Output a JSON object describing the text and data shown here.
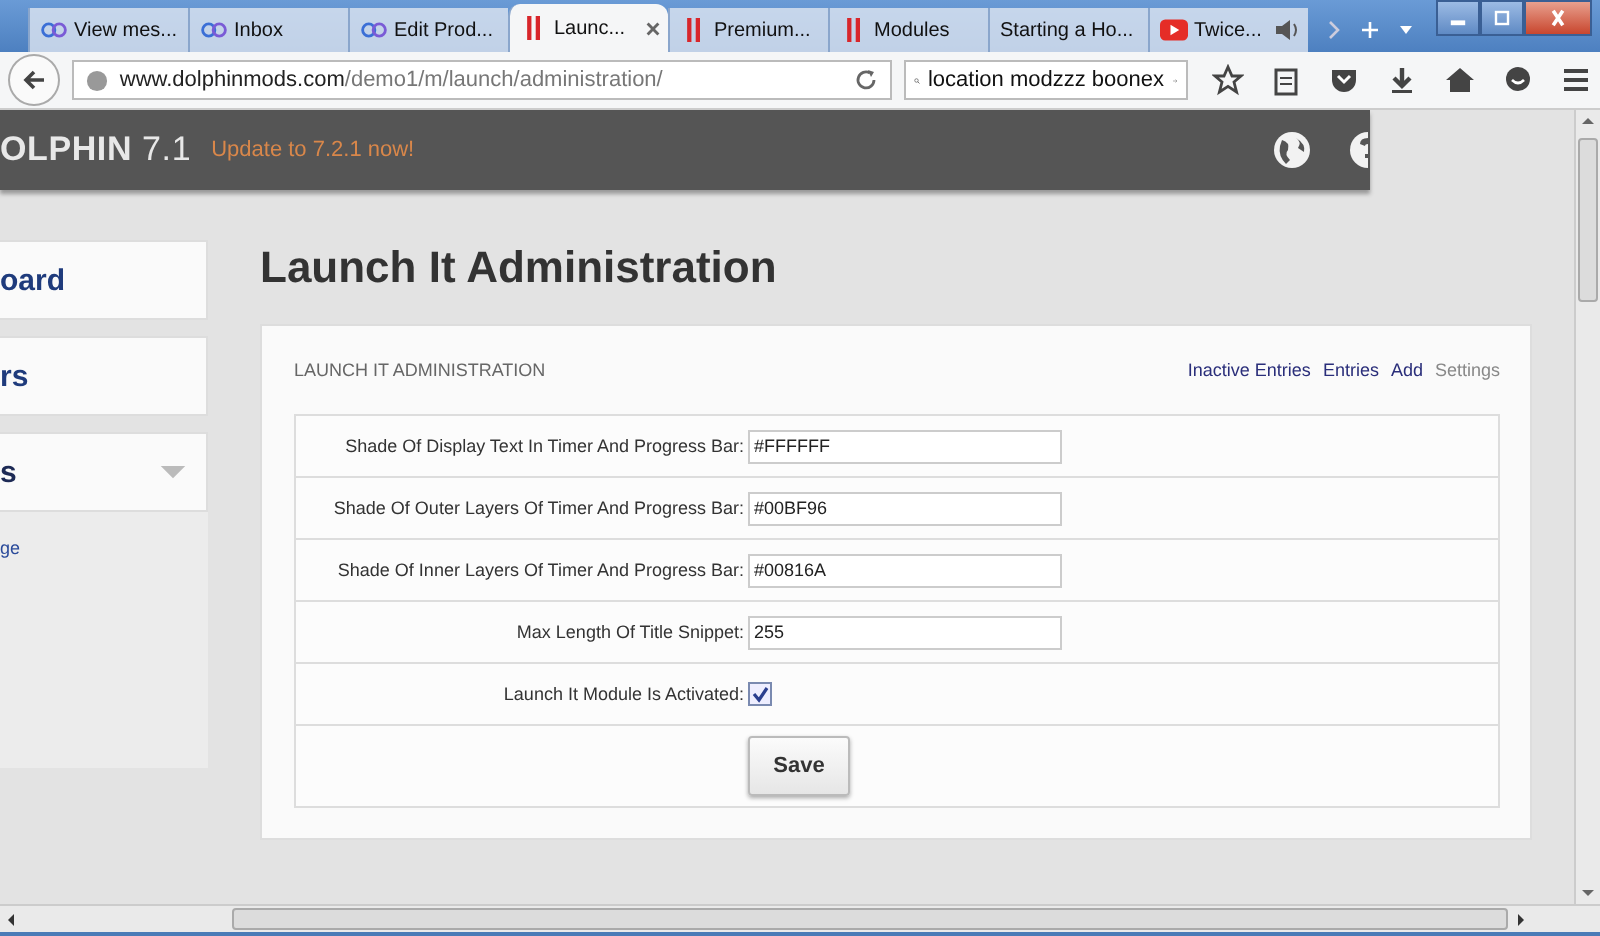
{
  "browser": {
    "tabs": [
      {
        "label": "View mes...",
        "kind": "circles",
        "selected": false
      },
      {
        "label": "Inbox",
        "kind": "circles",
        "selected": false
      },
      {
        "label": "Edit Prod...",
        "kind": "circles",
        "selected": false
      },
      {
        "label": "Launc...",
        "kind": "bars",
        "selected": true
      },
      {
        "label": "Premium...",
        "kind": "bars",
        "selected": false
      },
      {
        "label": "Modules",
        "kind": "bars",
        "selected": false
      },
      {
        "label": "Starting a Ho...",
        "kind": "plain",
        "selected": false
      },
      {
        "label": "Twice...",
        "kind": "video",
        "selected": false
      }
    ],
    "address": {
      "host": "www.dolphinmods.com",
      "path": "/demo1/m/launch/administration/"
    },
    "search": {
      "value": "location modzzz boonex"
    }
  },
  "header": {
    "logo": "OLPHIN",
    "version": "7.1",
    "update_link": "Update to 7.2.1 now!"
  },
  "sidebar": {
    "items": [
      {
        "label": "oard",
        "kind": "card"
      },
      {
        "label": "rs",
        "kind": "card"
      },
      {
        "label": "s",
        "kind": "menu"
      },
      {
        "label": "ge",
        "kind": "link"
      }
    ]
  },
  "page_title": "Launch It Administration",
  "panel": {
    "title": "LAUNCH IT ADMINISTRATION",
    "links": [
      {
        "label": "Inactive Entries",
        "selected": false
      },
      {
        "label": "Entries",
        "selected": false
      },
      {
        "label": "Add",
        "selected": false
      },
      {
        "label": "Settings",
        "selected": true
      }
    ],
    "fields": [
      {
        "label": "Shade Of Display Text In Timer And Progress Bar:",
        "kind": "text",
        "value": "#FFFFFF"
      },
      {
        "label": "Shade Of Outer Layers Of Timer And Progress Bar:",
        "kind": "text",
        "value": "#00BF96"
      },
      {
        "label": "Shade Of Inner Layers Of Timer And Progress Bar:",
        "kind": "text",
        "value": "#00816A"
      },
      {
        "label": "Max Length Of Title Snippet:",
        "kind": "text",
        "value": "255"
      },
      {
        "label": "Launch It Module Is Activated:",
        "kind": "checkbox",
        "checked": true
      }
    ],
    "button": "Save"
  }
}
